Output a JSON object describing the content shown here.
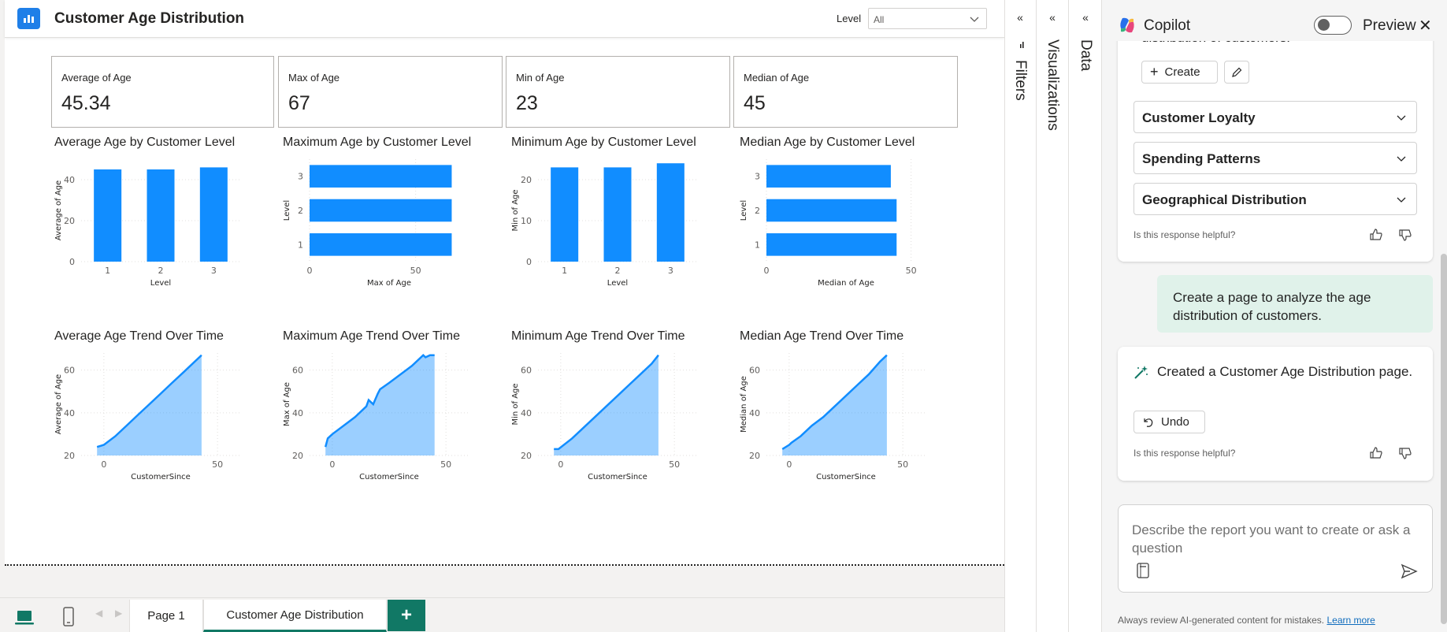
{
  "report": {
    "title": "Customer Age Distribution",
    "slicer_label": "Level",
    "slicer_value": "All"
  },
  "cards": [
    {
      "label": "Average of Age",
      "value": "45.34"
    },
    {
      "label": "Max of Age",
      "value": "67"
    },
    {
      "label": "Min of Age",
      "value": "23"
    },
    {
      "label": "Median of Age",
      "value": "45"
    }
  ],
  "chart_data": [
    {
      "type": "bar",
      "orientation": "vertical",
      "title": "Average Age by Customer Level",
      "categories": [
        "1",
        "2",
        "3"
      ],
      "values": [
        45,
        45,
        46
      ],
      "xlabel": "Level",
      "ylabel": "Average of Age",
      "ylim": [
        0,
        50
      ],
      "yticks": [
        0,
        20,
        40
      ],
      "color": "#118dff"
    },
    {
      "type": "bar",
      "orientation": "horizontal",
      "title": "Maximum Age by Customer Level",
      "categories": [
        "1",
        "2",
        "3"
      ],
      "values": [
        67,
        67,
        67
      ],
      "xlabel": "Max of Age",
      "ylabel": "Level",
      "xlim": [
        0,
        75
      ],
      "xticks": [
        0,
        50
      ],
      "color": "#118dff"
    },
    {
      "type": "bar",
      "orientation": "vertical",
      "title": "Minimum Age by Customer Level",
      "categories": [
        "1",
        "2",
        "3"
      ],
      "values": [
        23,
        23,
        24
      ],
      "xlabel": "Level",
      "ylabel": "Min of Age",
      "ylim": [
        0,
        25
      ],
      "yticks": [
        0,
        10,
        20
      ],
      "color": "#118dff"
    },
    {
      "type": "bar",
      "orientation": "horizontal",
      "title": "Median Age by Customer Level",
      "categories": [
        "1",
        "2",
        "3"
      ],
      "values": [
        45,
        45,
        43
      ],
      "xlabel": "Median of Age",
      "ylabel": "Level",
      "xlim": [
        0,
        55
      ],
      "xticks": [
        0,
        50
      ],
      "color": "#118dff"
    },
    {
      "type": "area",
      "title": "Average Age Trend Over Time",
      "x": [
        -3,
        0,
        5,
        10,
        15,
        20,
        25,
        30,
        35,
        40,
        43
      ],
      "y": [
        24,
        25,
        29,
        34,
        39,
        44,
        49,
        54,
        59,
        64,
        67
      ],
      "xlabel": "CustomerSince",
      "ylabel": "Average of Age",
      "xlim": [
        -10,
        60
      ],
      "ylim": [
        20,
        68
      ],
      "xticks": [
        0,
        50
      ],
      "yticks": [
        20,
        40,
        60
      ],
      "color": "#118dff"
    },
    {
      "type": "area",
      "title": "Maximum Age Trend Over Time",
      "x": [
        -3,
        -2,
        0,
        5,
        10,
        15,
        16,
        18,
        20,
        21,
        25,
        30,
        35,
        40,
        41,
        43,
        45
      ],
      "y": [
        24,
        28,
        30,
        34,
        38,
        43,
        46,
        44,
        49,
        51,
        54,
        58,
        62,
        67,
        66,
        67,
        67
      ],
      "xlabel": "CustomerSince",
      "ylabel": "Max of Age",
      "xlim": [
        -10,
        60
      ],
      "ylim": [
        20,
        68
      ],
      "xticks": [
        0,
        50
      ],
      "yticks": [
        20,
        40,
        60
      ],
      "color": "#118dff"
    },
    {
      "type": "area",
      "title": "Minimum Age Trend Over Time",
      "x": [
        -3,
        -1,
        5,
        10,
        15,
        20,
        25,
        30,
        35,
        40,
        43
      ],
      "y": [
        23,
        23,
        28,
        33,
        38,
        43,
        48,
        53,
        58,
        63,
        67
      ],
      "xlabel": "CustomerSince",
      "ylabel": "Min of Age",
      "xlim": [
        -10,
        60
      ],
      "ylim": [
        20,
        68
      ],
      "xticks": [
        0,
        50
      ],
      "yticks": [
        20,
        40,
        60
      ],
      "color": "#118dff"
    },
    {
      "type": "area",
      "title": "Median Age Trend Over Time",
      "x": [
        -3,
        0,
        1,
        5,
        10,
        15,
        20,
        25,
        30,
        35,
        40,
        43
      ],
      "y": [
        23,
        25,
        26,
        29,
        34,
        38,
        43,
        48,
        53,
        58,
        64,
        67
      ],
      "xlabel": "CustomerSince",
      "ylabel": "Median of Age",
      "xlim": [
        -10,
        60
      ],
      "ylim": [
        20,
        68
      ],
      "xticks": [
        0,
        50
      ],
      "yticks": [
        20,
        40,
        60
      ],
      "color": "#118dff"
    }
  ],
  "page_tabs": [
    "Page 1",
    "Customer Age Distribution"
  ],
  "panes": {
    "filters": "Filters",
    "visualizations": "Visualizations",
    "data": "Data",
    "collapse_glyph": "«"
  },
  "copilot": {
    "title": "Copilot",
    "preview_label": "Preview",
    "close_glyph": "✕",
    "cut_text": "distribution of customers.",
    "create_label": "Create",
    "accordions": [
      "Customer Loyalty",
      "Spending Patterns",
      "Geographical Distribution"
    ],
    "helpful_prompt": "Is this response helpful?",
    "user_message": "Create a page to analyze the age distribution of customers.",
    "assistant_message": "Created a Customer Age Distribution page.",
    "undo_label": "Undo",
    "input_placeholder": "Describe the report you want to create or ask a question",
    "disclaimer": "Always review AI-generated content for mistakes.",
    "learn_more": "Learn more"
  }
}
